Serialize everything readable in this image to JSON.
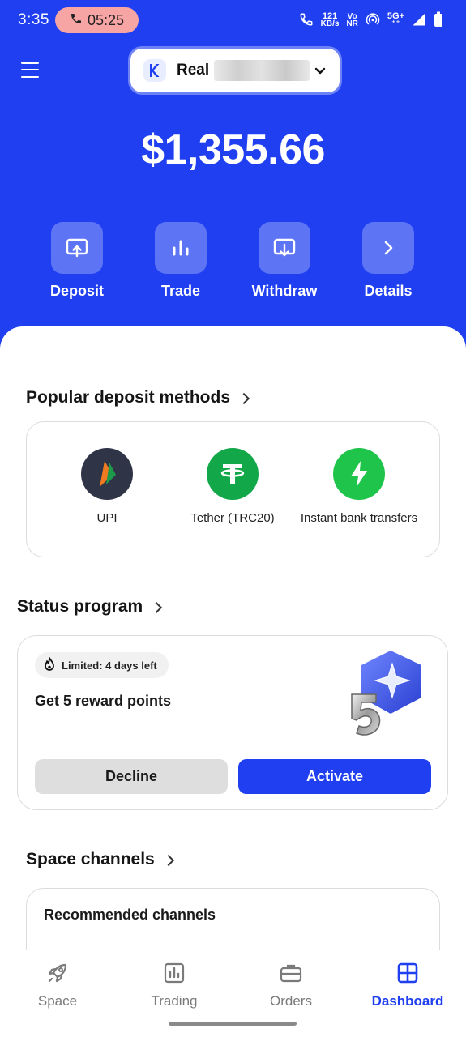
{
  "status_bar": {
    "time": "3:35",
    "call_timer": "05:25",
    "net_speed": "121",
    "net_unit": "KB/s",
    "volte_top": "Vo",
    "volte_bottom": "NR",
    "network": "5G+"
  },
  "header": {
    "account_label": "Real",
    "balance": "$1,355.66"
  },
  "actions": [
    {
      "label": "Deposit",
      "icon": "deposit-icon"
    },
    {
      "label": "Trade",
      "icon": "bar-chart-icon"
    },
    {
      "label": "Withdraw",
      "icon": "withdraw-icon"
    },
    {
      "label": "Details",
      "icon": "chevron-right-icon"
    }
  ],
  "deposit_methods": {
    "title": "Popular deposit methods",
    "items": [
      {
        "label": "UPI",
        "icon": "upi-icon",
        "color": "#2f3547"
      },
      {
        "label": "Tether (TRC20)",
        "icon": "tether-icon",
        "color": "#12a84a"
      },
      {
        "label": "Instant bank transfers",
        "icon": "lightning-icon",
        "color": "#1fc44a"
      }
    ]
  },
  "status_program": {
    "title": "Status program",
    "limited": "Limited: 4 days left",
    "reward": "Get 5 reward points",
    "decline": "Decline",
    "activate": "Activate"
  },
  "space_channels": {
    "title": "Space channels",
    "recommended": "Recommended channels"
  },
  "bottom_nav": [
    {
      "label": "Space",
      "icon": "rocket-icon",
      "active": false
    },
    {
      "label": "Trading",
      "icon": "chart-icon",
      "active": false
    },
    {
      "label": "Orders",
      "icon": "briefcase-icon",
      "active": false
    },
    {
      "label": "Dashboard",
      "icon": "dashboard-icon",
      "active": true
    }
  ],
  "colors": {
    "brand_blue": "#1f3ff0",
    "call_pill": "#f7a4a4"
  }
}
